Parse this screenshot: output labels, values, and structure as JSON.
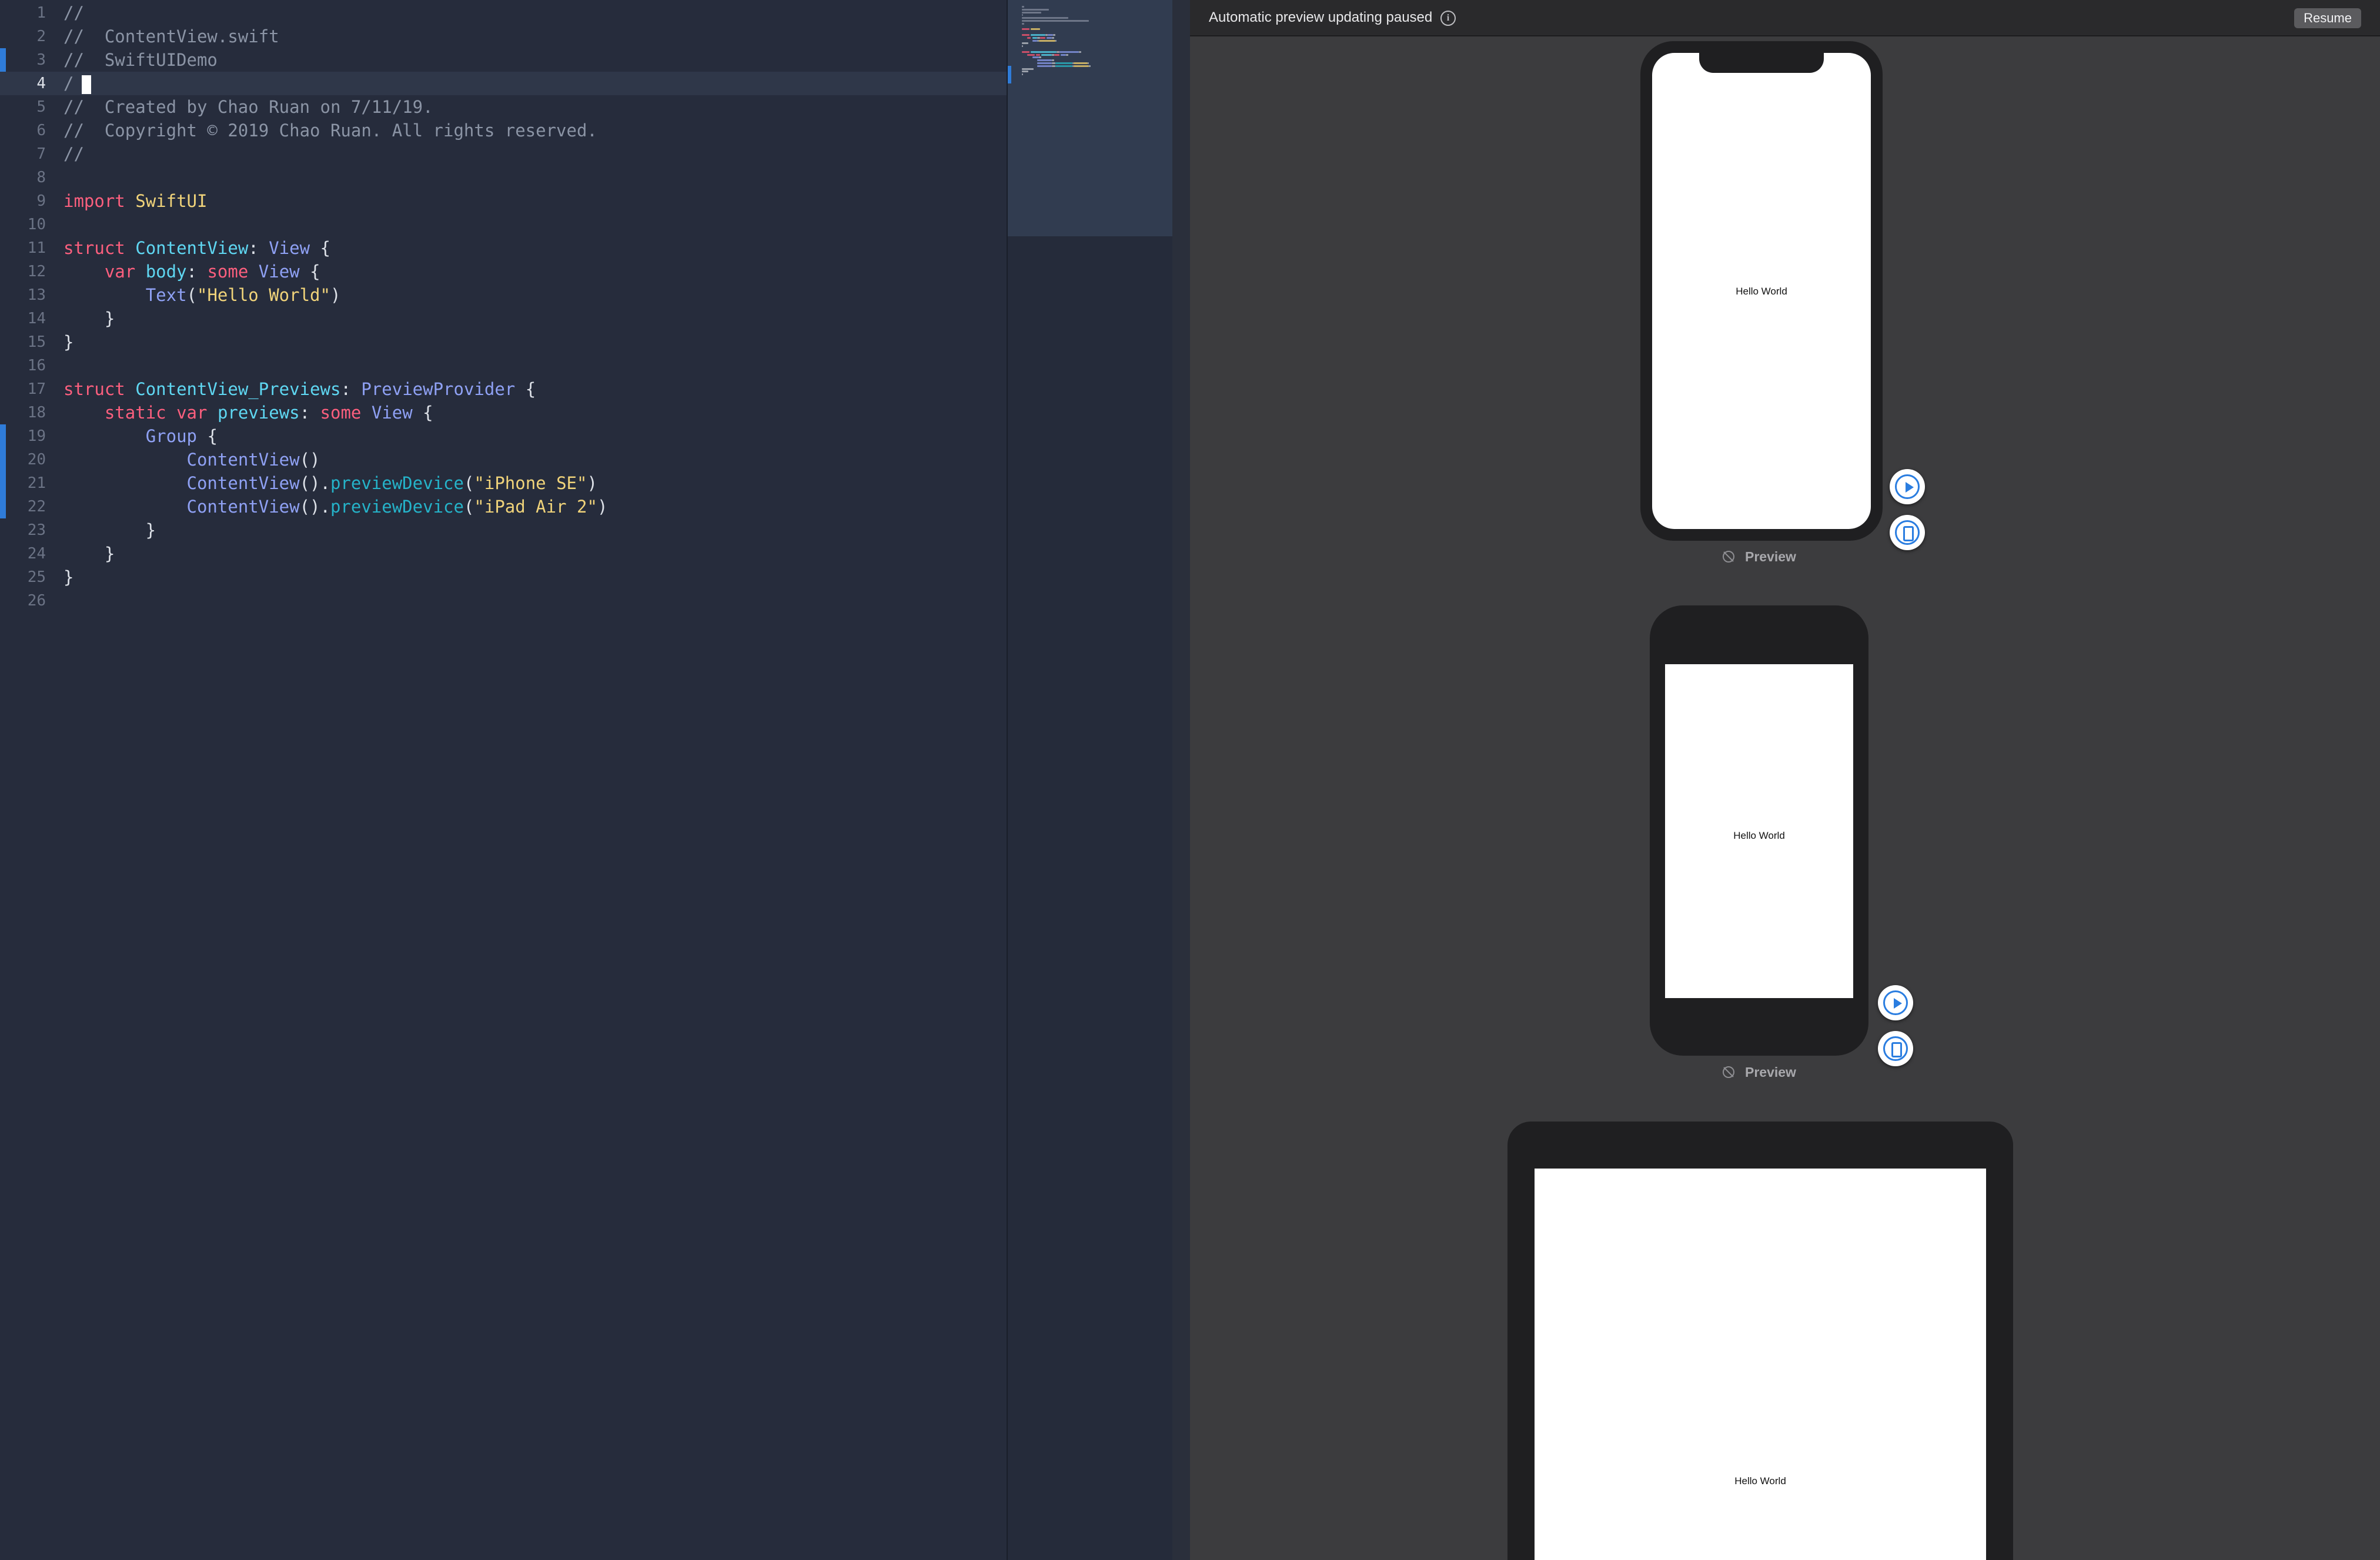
{
  "editor": {
    "current_line": 4,
    "lines": [
      {
        "n": "1",
        "mark": false,
        "tokens": [
          {
            "c": "t-comment",
            "t": "//"
          }
        ]
      },
      {
        "n": "2",
        "mark": false,
        "tokens": [
          {
            "c": "t-comment",
            "t": "//  ContentView.swift"
          }
        ]
      },
      {
        "n": "3",
        "mark": true,
        "tokens": [
          {
            "c": "t-comment",
            "t": "//  SwiftUIDemo"
          }
        ]
      },
      {
        "n": "4",
        "mark": false,
        "tokens": [
          {
            "c": "t-comment",
            "t": "/"
          }
        ]
      },
      {
        "n": "5",
        "mark": false,
        "tokens": [
          {
            "c": "t-comment",
            "t": "//  Created by Chao Ruan on 7/11/19."
          }
        ]
      },
      {
        "n": "6",
        "mark": false,
        "tokens": [
          {
            "c": "t-comment",
            "t": "//  Copyright © 2019 Chao Ruan. All rights reserved."
          }
        ]
      },
      {
        "n": "7",
        "mark": false,
        "tokens": [
          {
            "c": "t-comment",
            "t": "//"
          }
        ]
      },
      {
        "n": "8",
        "mark": false,
        "tokens": []
      },
      {
        "n": "9",
        "mark": false,
        "tokens": [
          {
            "c": "t-kw",
            "t": "import"
          },
          {
            "c": "t-plain",
            "t": " "
          },
          {
            "c": "t-import",
            "t": "SwiftUI"
          }
        ]
      },
      {
        "n": "10",
        "mark": false,
        "tokens": []
      },
      {
        "n": "11",
        "mark": false,
        "tokens": [
          {
            "c": "t-kw",
            "t": "struct"
          },
          {
            "c": "t-plain",
            "t": " "
          },
          {
            "c": "t-decl",
            "t": "ContentView"
          },
          {
            "c": "t-plain",
            "t": ": "
          },
          {
            "c": "t-type",
            "t": "View"
          },
          {
            "c": "t-plain",
            "t": " {"
          }
        ]
      },
      {
        "n": "12",
        "mark": false,
        "tokens": [
          {
            "c": "t-plain",
            "t": "    "
          },
          {
            "c": "t-kw",
            "t": "var"
          },
          {
            "c": "t-plain",
            "t": " "
          },
          {
            "c": "t-decl",
            "t": "body"
          },
          {
            "c": "t-plain",
            "t": ": "
          },
          {
            "c": "t-kw",
            "t": "some"
          },
          {
            "c": "t-plain",
            "t": " "
          },
          {
            "c": "t-type",
            "t": "View"
          },
          {
            "c": "t-plain",
            "t": " {"
          }
        ]
      },
      {
        "n": "13",
        "mark": false,
        "tokens": [
          {
            "c": "t-plain",
            "t": "        "
          },
          {
            "c": "t-type",
            "t": "Text"
          },
          {
            "c": "t-plain",
            "t": "("
          },
          {
            "c": "t-str",
            "t": "\"Hello World\""
          },
          {
            "c": "t-plain",
            "t": ")"
          }
        ]
      },
      {
        "n": "14",
        "mark": false,
        "tokens": [
          {
            "c": "t-plain",
            "t": "    }"
          }
        ]
      },
      {
        "n": "15",
        "mark": false,
        "tokens": [
          {
            "c": "t-plain",
            "t": "}"
          }
        ]
      },
      {
        "n": "16",
        "mark": false,
        "tokens": []
      },
      {
        "n": "17",
        "mark": false,
        "tokens": [
          {
            "c": "t-kw",
            "t": "struct"
          },
          {
            "c": "t-plain",
            "t": " "
          },
          {
            "c": "t-decl",
            "t": "ContentView_Previews"
          },
          {
            "c": "t-plain",
            "t": ": "
          },
          {
            "c": "t-type",
            "t": "PreviewProvider"
          },
          {
            "c": "t-plain",
            "t": " {"
          }
        ]
      },
      {
        "n": "18",
        "mark": false,
        "tokens": [
          {
            "c": "t-plain",
            "t": "    "
          },
          {
            "c": "t-kw",
            "t": "static"
          },
          {
            "c": "t-plain",
            "t": " "
          },
          {
            "c": "t-kw",
            "t": "var"
          },
          {
            "c": "t-plain",
            "t": " "
          },
          {
            "c": "t-decl",
            "t": "previews"
          },
          {
            "c": "t-plain",
            "t": ": "
          },
          {
            "c": "t-kw",
            "t": "some"
          },
          {
            "c": "t-plain",
            "t": " "
          },
          {
            "c": "t-type",
            "t": "View"
          },
          {
            "c": "t-plain",
            "t": " {"
          }
        ]
      },
      {
        "n": "19",
        "mark": true,
        "tokens": [
          {
            "c": "t-plain",
            "t": "        "
          },
          {
            "c": "t-type",
            "t": "Group"
          },
          {
            "c": "t-plain",
            "t": " {"
          }
        ]
      },
      {
        "n": "20",
        "mark": true,
        "tokens": [
          {
            "c": "t-plain",
            "t": "            "
          },
          {
            "c": "t-type",
            "t": "ContentView"
          },
          {
            "c": "t-plain",
            "t": "()"
          }
        ]
      },
      {
        "n": "21",
        "mark": true,
        "tokens": [
          {
            "c": "t-plain",
            "t": "            "
          },
          {
            "c": "t-type",
            "t": "ContentView"
          },
          {
            "c": "t-plain",
            "t": "()."
          },
          {
            "c": "t-fn",
            "t": "previewDevice"
          },
          {
            "c": "t-plain",
            "t": "("
          },
          {
            "c": "t-str",
            "t": "\"iPhone SE\""
          },
          {
            "c": "t-plain",
            "t": ")"
          }
        ]
      },
      {
        "n": "22",
        "mark": true,
        "tokens": [
          {
            "c": "t-plain",
            "t": "            "
          },
          {
            "c": "t-type",
            "t": "ContentView"
          },
          {
            "c": "t-plain",
            "t": "()."
          },
          {
            "c": "t-fn",
            "t": "previewDevice"
          },
          {
            "c": "t-plain",
            "t": "("
          },
          {
            "c": "t-str",
            "t": "\"iPad Air 2\""
          },
          {
            "c": "t-plain",
            "t": ")"
          }
        ]
      },
      {
        "n": "23",
        "mark": false,
        "tokens": [
          {
            "c": "t-plain",
            "t": "        }"
          }
        ]
      },
      {
        "n": "24",
        "mark": false,
        "tokens": [
          {
            "c": "t-plain",
            "t": "    }"
          }
        ]
      },
      {
        "n": "25",
        "mark": false,
        "tokens": [
          {
            "c": "t-plain",
            "t": "}"
          }
        ]
      },
      {
        "n": "26",
        "mark": false,
        "tokens": []
      }
    ]
  },
  "canvas": {
    "status_text": "Automatic preview updating paused",
    "resume_label": "Resume",
    "previews": [
      {
        "hello": "Hello World",
        "label": "Preview"
      },
      {
        "hello": "Hello World",
        "label": "Preview"
      },
      {
        "hello": "Hello World"
      }
    ]
  },
  "colors": {
    "editor_bg": "#262c3c",
    "keyword": "#fc5f7e",
    "type": "#8fa1f4",
    "declaration": "#5fd7f2",
    "string": "#f0d37a",
    "comment": "#8b94a5",
    "accent_blue": "#2a7de0"
  }
}
